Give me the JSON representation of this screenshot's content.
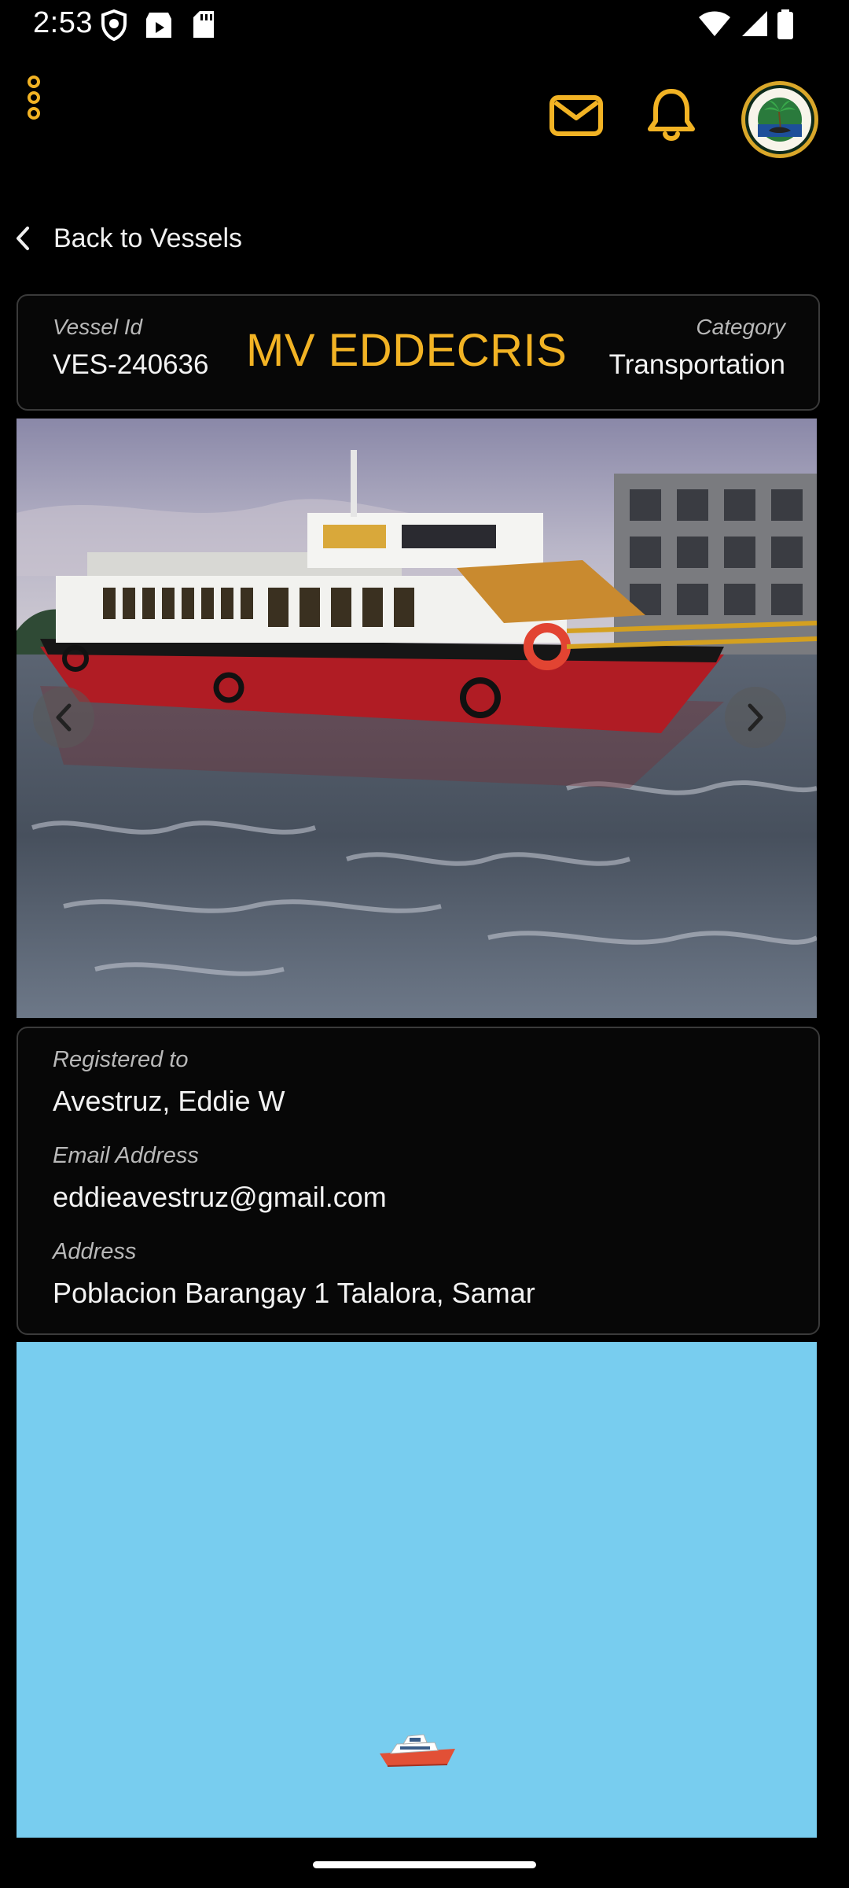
{
  "status_bar": {
    "time": "2:53",
    "icons": [
      "vpn-shield-icon",
      "play-store-icon",
      "sd-card-icon",
      "wifi-icon",
      "cellular-signal-icon",
      "battery-icon"
    ]
  },
  "app_bar": {
    "icons": [
      "more-vert-icon",
      "mail-icon",
      "bell-icon",
      "seal-logo"
    ],
    "accent_color": "#f2b324"
  },
  "nav": {
    "back_label": "Back to Vessels"
  },
  "vessel": {
    "id_label": "Vessel Id",
    "id_value": "VES-240636",
    "name": "MV EDDECRIS",
    "category_label": "Category",
    "category_value": "Transportation"
  },
  "owner": {
    "registered_label": "Registered to",
    "registered_value": "Avestruz, Eddie W",
    "email_label": "Email Address",
    "email_value": "eddieavestruz@gmail.com",
    "address_label": "Address",
    "address_value": "Poblacion Barangay 1 Talalora, Samar"
  },
  "map": {
    "background_color": "#78cdef",
    "marker_icon": "boat-marker-icon"
  }
}
